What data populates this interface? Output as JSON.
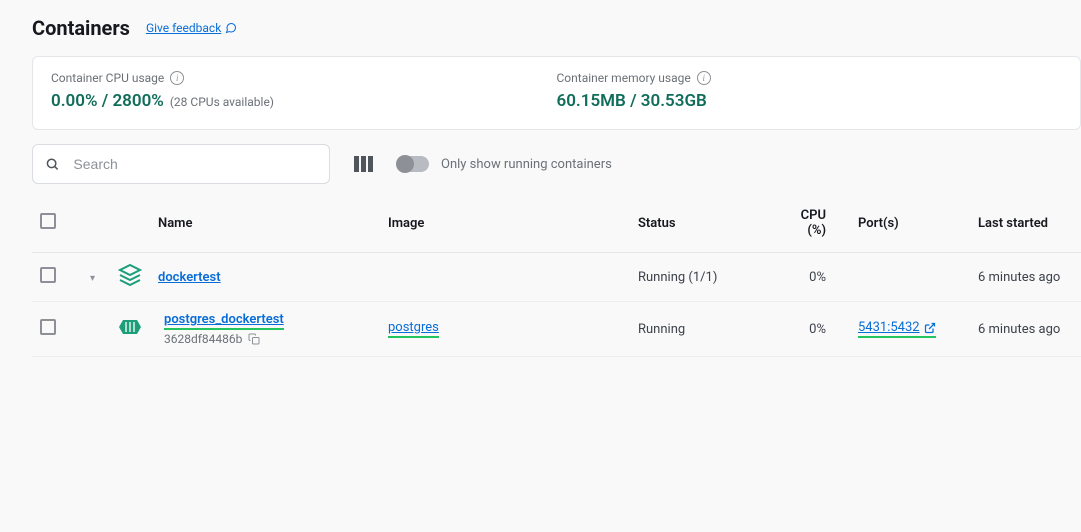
{
  "header": {
    "title": "Containers",
    "feedback_label": "Give feedback"
  },
  "stats": {
    "cpu": {
      "label": "Container CPU usage",
      "used": "0.00%",
      "sep": " / ",
      "total": "2800%",
      "note": "(28 CPUs available)"
    },
    "memory": {
      "label": "Container memory usage",
      "used": "60.15MB",
      "sep": " / ",
      "total": "30.53GB"
    }
  },
  "toolbar": {
    "search_placeholder": "Search",
    "toggle_label": "Only show running containers"
  },
  "table": {
    "headers": {
      "name": "Name",
      "image": "Image",
      "status": "Status",
      "cpu": "CPU (%)",
      "ports": "Port(s)",
      "last_started": "Last started"
    },
    "rows": [
      {
        "type": "stack",
        "name": "dockertest",
        "image": "",
        "status": "Running (1/1)",
        "cpu": "0%",
        "ports": "",
        "last_started": "6 minutes ago"
      },
      {
        "type": "container",
        "name": "postgres_dockertest",
        "id": "3628df84486b",
        "image": "postgres",
        "status": "Running",
        "cpu": "0%",
        "ports": "5431:5432",
        "last_started": "6 minutes ago"
      }
    ]
  }
}
